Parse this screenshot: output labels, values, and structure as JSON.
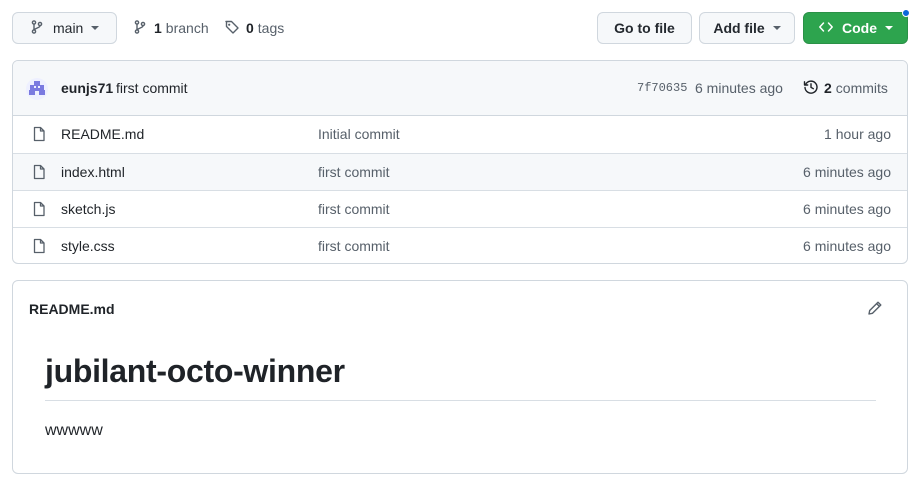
{
  "toolbar": {
    "branch_name": "main",
    "branch_count": "1",
    "branch_label": "branch",
    "tag_count": "0",
    "tag_label": "tags",
    "goto_file_label": "Go to file",
    "add_file_label": "Add file",
    "code_label": "Code"
  },
  "latest_commit": {
    "author": "eunjs71",
    "message": "first commit",
    "sha": "7f70635",
    "time": "6 minutes ago",
    "commit_count": "2",
    "commit_label": "commits"
  },
  "files": [
    {
      "name": "README.md",
      "message": "Initial commit",
      "time": "1 hour ago"
    },
    {
      "name": "index.html",
      "message": "first commit",
      "time": "6 minutes ago"
    },
    {
      "name": "sketch.js",
      "message": "first commit",
      "time": "6 minutes ago"
    },
    {
      "name": "style.css",
      "message": "first commit",
      "time": "6 minutes ago"
    }
  ],
  "readme": {
    "filename": "README.md",
    "heading": "jubilant-octo-winner",
    "body": "wwwww"
  },
  "colors": {
    "code_button": "#2da44e",
    "notification_dot": "#0969da",
    "border": "#d0d7de"
  },
  "icons": {
    "branch": "git-branch-icon",
    "tag": "tag-icon",
    "history": "history-icon",
    "file": "file-icon",
    "edit": "pencil-icon",
    "code": "code-icon"
  }
}
